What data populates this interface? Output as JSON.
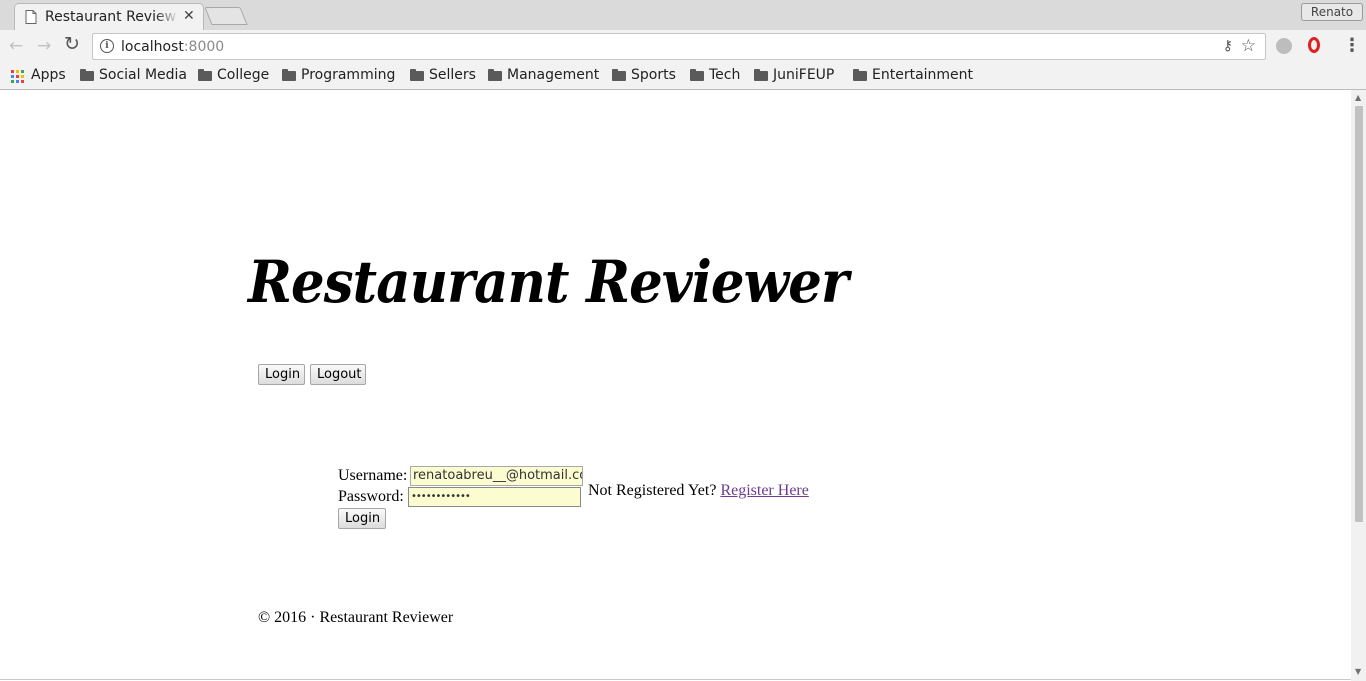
{
  "browser": {
    "tab_title": "Restaurant Reviewer",
    "profile_name": "Renato",
    "url_host": "localhost",
    "url_port": ":8000"
  },
  "bookmarks": [
    {
      "label": "Apps",
      "icon": "apps-grid-icon"
    },
    {
      "label": "Social Media",
      "icon": "folder-icon"
    },
    {
      "label": "College",
      "icon": "folder-icon"
    },
    {
      "label": "Programming",
      "icon": "folder-icon"
    },
    {
      "label": "Sellers",
      "icon": "folder-icon"
    },
    {
      "label": "Management",
      "icon": "folder-icon"
    },
    {
      "label": "Sports",
      "icon": "folder-icon"
    },
    {
      "label": "Tech",
      "icon": "folder-icon"
    },
    {
      "label": "JuniFEUP",
      "icon": "folder-icon"
    },
    {
      "label": "Entertainment",
      "icon": "folder-icon"
    }
  ],
  "page": {
    "logo_text": "Restaurant Reviewer",
    "nav": {
      "login_label": "Login",
      "logout_label": "Logout"
    },
    "form": {
      "username_label": "Username:",
      "username_value": "renatoabreu__@hotmail.com",
      "password_label": "Password:",
      "password_masked": "••••••••••••",
      "not_registered_text": "Not Registered Yet?",
      "register_link": "Register Here",
      "submit_label": "Login"
    },
    "footer": "© 2016 · Restaurant Reviewer"
  },
  "colors": {
    "autofill_bg": "#fbfdd0",
    "visited_link": "#6d3b8f",
    "opera_red": "#e02020"
  }
}
